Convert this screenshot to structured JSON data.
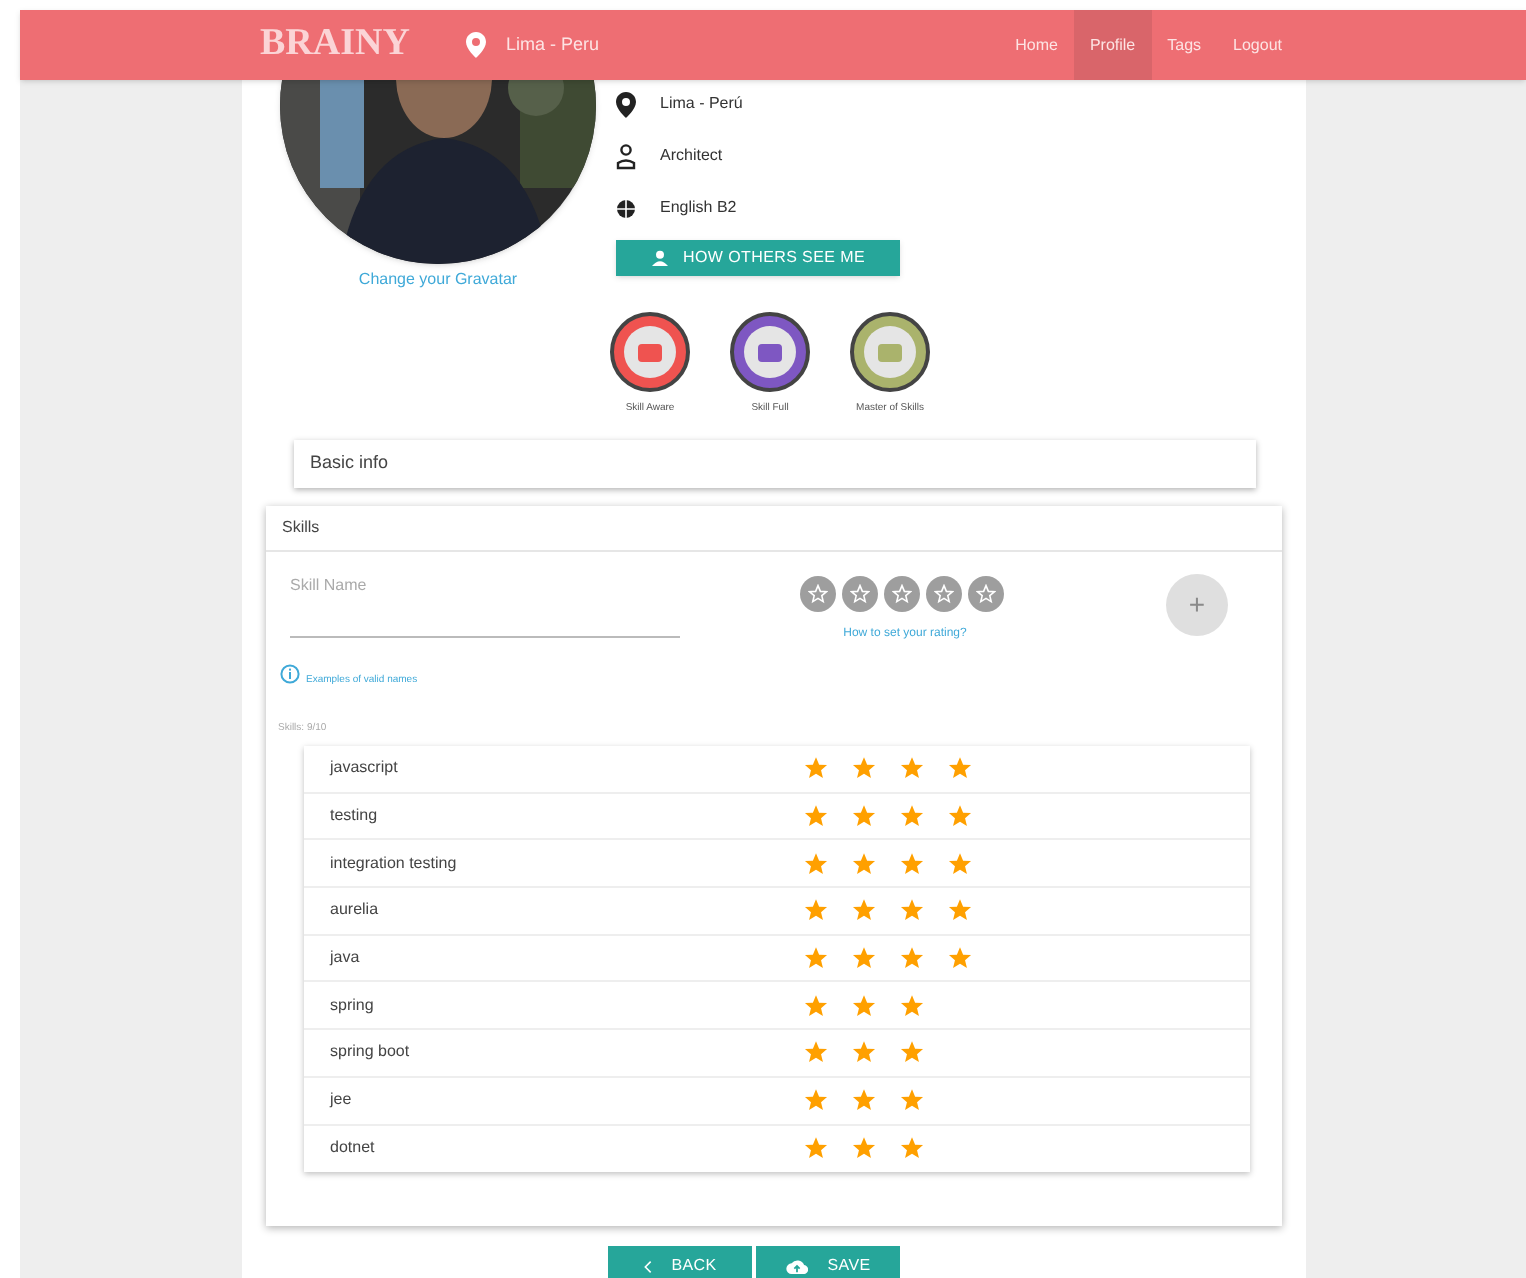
{
  "navbar": {
    "brand": "BRAINY",
    "location": "Lima - Peru",
    "links": [
      {
        "label": "Home",
        "selected": false
      },
      {
        "label": "Profile",
        "selected": true
      },
      {
        "label": "Tags",
        "selected": false
      },
      {
        "label": "Logout",
        "selected": false
      }
    ]
  },
  "profile": {
    "gravatar_link": "Change your Gravatar",
    "details": [
      {
        "kind": "location",
        "text": "Lima - Perú"
      },
      {
        "kind": "occupation",
        "text": "Architect"
      },
      {
        "kind": "language",
        "text": "English B2"
      }
    ],
    "view_button": "HOW OTHERS SEE ME",
    "badges": [
      {
        "label": "Skill Aware",
        "color": "#ef5350"
      },
      {
        "label": "Skill Full",
        "color": "#7e57c2"
      },
      {
        "label": "Master of Skills",
        "color": "#aab36c"
      }
    ]
  },
  "basic_info": {
    "title": "Basic info"
  },
  "skills": {
    "title": "Skills",
    "name_field": {
      "placeholder": "Skill Name"
    },
    "rating_help": "How to set your rating?",
    "add_button": "+",
    "examples_link": "Examples of valid names",
    "count": "Skills: 9/10",
    "rows": [
      {
        "name": "javascript",
        "stars": 4
      },
      {
        "name": "testing",
        "stars": 4
      },
      {
        "name": "integration testing",
        "stars": 4
      },
      {
        "name": "aurelia",
        "stars": 4
      },
      {
        "name": "java",
        "stars": 4
      },
      {
        "name": "spring",
        "stars": 3
      },
      {
        "name": "spring boot",
        "stars": 3
      },
      {
        "name": "jee",
        "stars": 3
      },
      {
        "name": "dotnet",
        "stars": 3
      }
    ]
  },
  "buttons": [
    {
      "kind": "back",
      "label": "BACK"
    },
    {
      "kind": "save",
      "label": "SAVE"
    }
  ]
}
